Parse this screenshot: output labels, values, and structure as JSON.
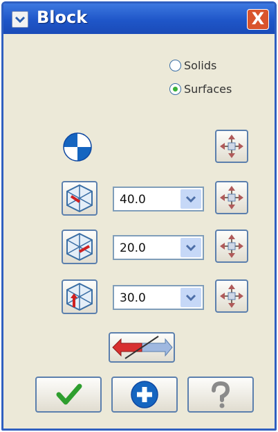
{
  "window": {
    "title": "Block",
    "close_label": "X"
  },
  "mode": {
    "options": [
      {
        "label": "Solids",
        "selected": false
      },
      {
        "label": "Surfaces",
        "selected": true
      }
    ]
  },
  "dimensions": [
    {
      "value": "40.0"
    },
    {
      "value": "20.0"
    },
    {
      "value": "30.0"
    }
  ],
  "icons": {
    "system_menu": "chevron-down-icon",
    "anchor": "anchor-point-icon",
    "move": "move-arrows-icon",
    "length": "block-length-icon",
    "width": "block-width-icon",
    "height": "block-height-icon",
    "direction": "direction-arrow-icon",
    "ok": "checkmark-icon",
    "apply": "plus-icon",
    "help": "question-icon"
  },
  "colors": {
    "title_bar": "#1f56c8",
    "dialog_bg": "#ece9d8",
    "accent_blue": "#1565c0",
    "ok_green": "#2e9e2e"
  }
}
